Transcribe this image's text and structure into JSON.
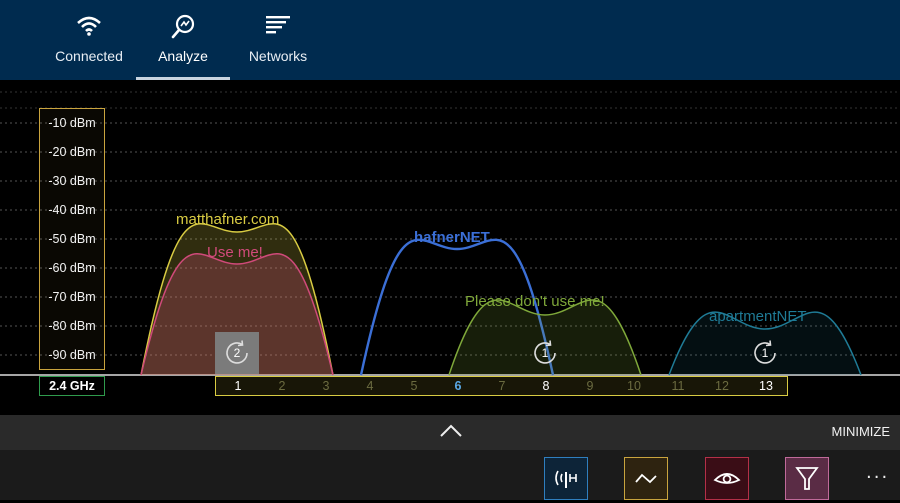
{
  "tabs": [
    {
      "label": "Connected",
      "icon": "wifi-icon"
    },
    {
      "label": "Analyze",
      "icon": "magnifier-icon",
      "active": true
    },
    {
      "label": "Networks",
      "icon": "list-icon"
    }
  ],
  "signal_axis": {
    "labels": [
      "-10 dBm",
      "-20 dBm",
      "-30 dBm",
      "-40 dBm",
      "-50 dBm",
      "-60 dBm",
      "-70 dBm",
      "-80 dBm",
      "-90 dBm"
    ]
  },
  "band": "2.4 GHz",
  "channels": [
    {
      "label": "1",
      "state": "used"
    },
    {
      "label": "2",
      "state": "unused"
    },
    {
      "label": "3",
      "state": "unused"
    },
    {
      "label": "4",
      "state": "unused"
    },
    {
      "label": "5",
      "state": "unused"
    },
    {
      "label": "6",
      "state": "selected"
    },
    {
      "label": "7",
      "state": "unused"
    },
    {
      "label": "8",
      "state": "used"
    },
    {
      "label": "9",
      "state": "unused"
    },
    {
      "label": "10",
      "state": "unused"
    },
    {
      "label": "11",
      "state": "unused"
    },
    {
      "label": "12",
      "state": "unused"
    },
    {
      "label": "13",
      "state": "used"
    }
  ],
  "networks": [
    {
      "name": "matthafner.com",
      "channel": 1,
      "color": "#d9cc43"
    },
    {
      "name": "Use me!",
      "channel": 1,
      "color": "#d04a7a"
    },
    {
      "name": "hafnerNET",
      "channel": 6,
      "color": "#3b6fd6"
    },
    {
      "name": "Please don't use me!",
      "channel": 8,
      "color": "#7fa83a"
    },
    {
      "name": "apartmentNET",
      "channel": 13,
      "color": "#1f7b96"
    }
  ],
  "channel_counts": [
    {
      "channel": 1,
      "count": "2"
    },
    {
      "channel": 8,
      "count": "1"
    },
    {
      "channel": 13,
      "count": "1"
    }
  ],
  "collapse": {
    "minimize_label": "MINIMIZE"
  },
  "toolbar": {
    "buttons": [
      {
        "icon": "antenna-icon",
        "color": "#2f7fbf"
      },
      {
        "icon": "wave-icon",
        "color": "#c9a43e"
      },
      {
        "icon": "eye-icon",
        "color": "#b43048"
      },
      {
        "icon": "filter-icon",
        "color": "#c06a9a"
      }
    ],
    "more_label": "..."
  }
}
